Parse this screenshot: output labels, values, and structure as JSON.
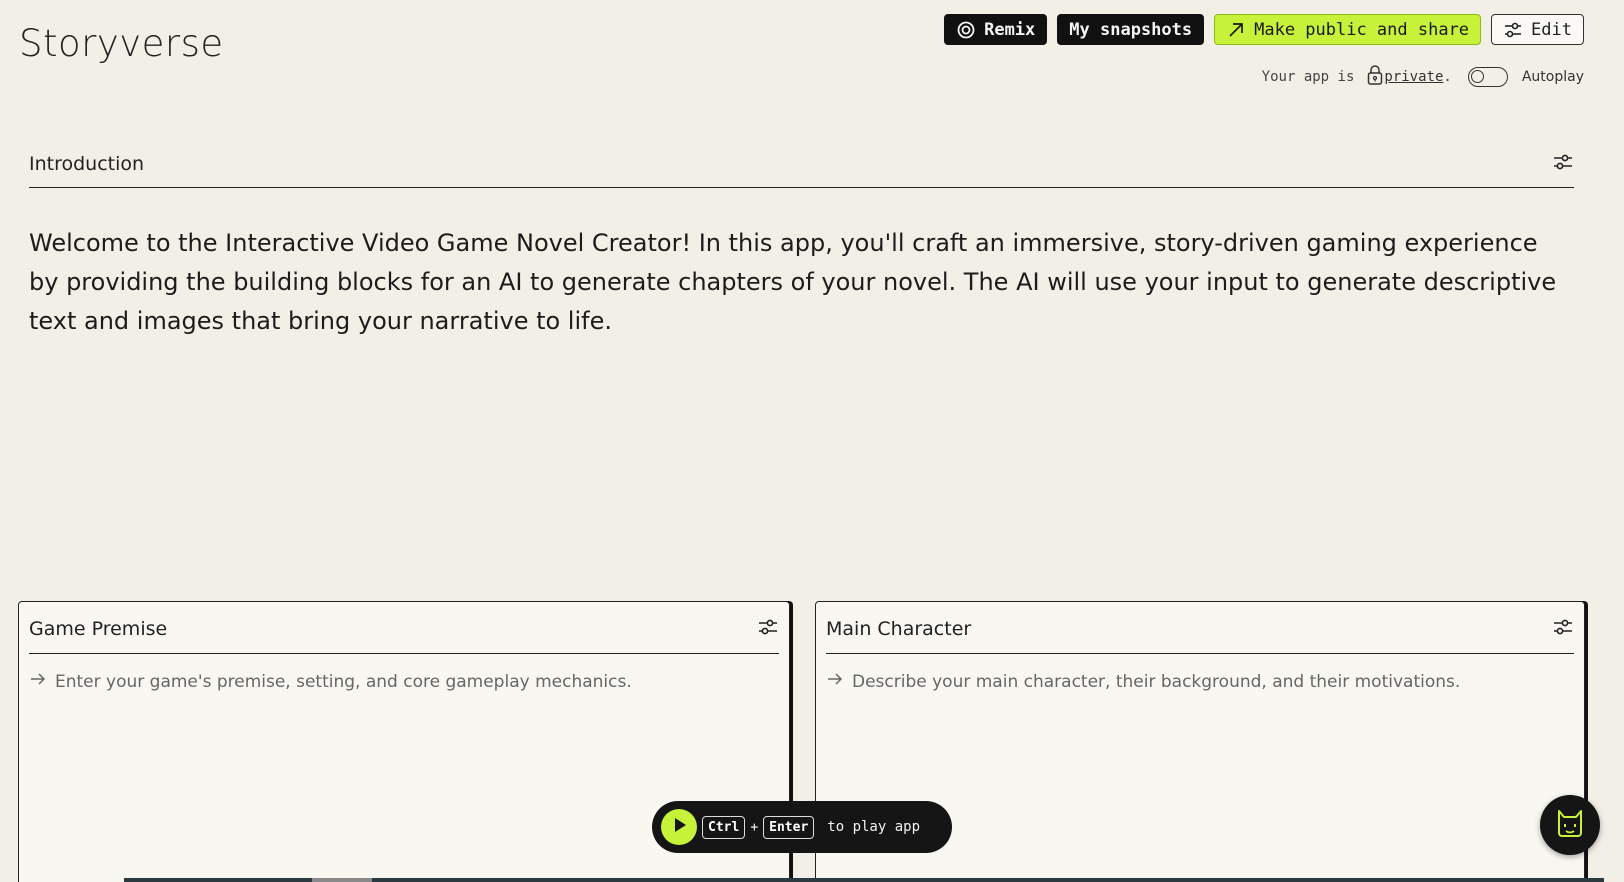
{
  "app": {
    "title": "Storyverse"
  },
  "toolbar": {
    "remix_label": "Remix",
    "snapshots_label": "My snapshots",
    "share_label": "Make public and share",
    "edit_label": "Edit"
  },
  "status": {
    "prefix": "Your app is",
    "visibility": "private",
    "suffix": ".",
    "autoplay_label": "Autoplay",
    "autoplay_on": false
  },
  "intro": {
    "title": "Introduction",
    "text": "Welcome to the Interactive Video Game Novel Creator! In this app, you'll craft an immersive, story-driven gaming experience by providing the building blocks for an AI to generate chapters of your novel. The AI will use your input to generate descriptive text and images that bring your narrative to life."
  },
  "cards": [
    {
      "title": "Game Premise",
      "placeholder": "Enter your game's premise, setting, and core gameplay mechanics."
    },
    {
      "title": "Main Character",
      "placeholder": "Describe your main character, their background, and their motivations."
    }
  ],
  "play_bar": {
    "key1": "Ctrl",
    "plus": "+",
    "key2": "Enter",
    "hint": "to play app"
  },
  "colors": {
    "background": "#f2efe6",
    "accent_green": "#c6f23a",
    "dark": "#111111"
  },
  "icons": {
    "remix": "remix-icon",
    "share": "arrow-up-right-icon",
    "edit": "sliders-icon",
    "lock": "lock-icon",
    "settings": "sliders-icon",
    "prompt_arrow": "arrow-right-icon",
    "play": "play-icon",
    "assistant": "cat-face-icon"
  }
}
